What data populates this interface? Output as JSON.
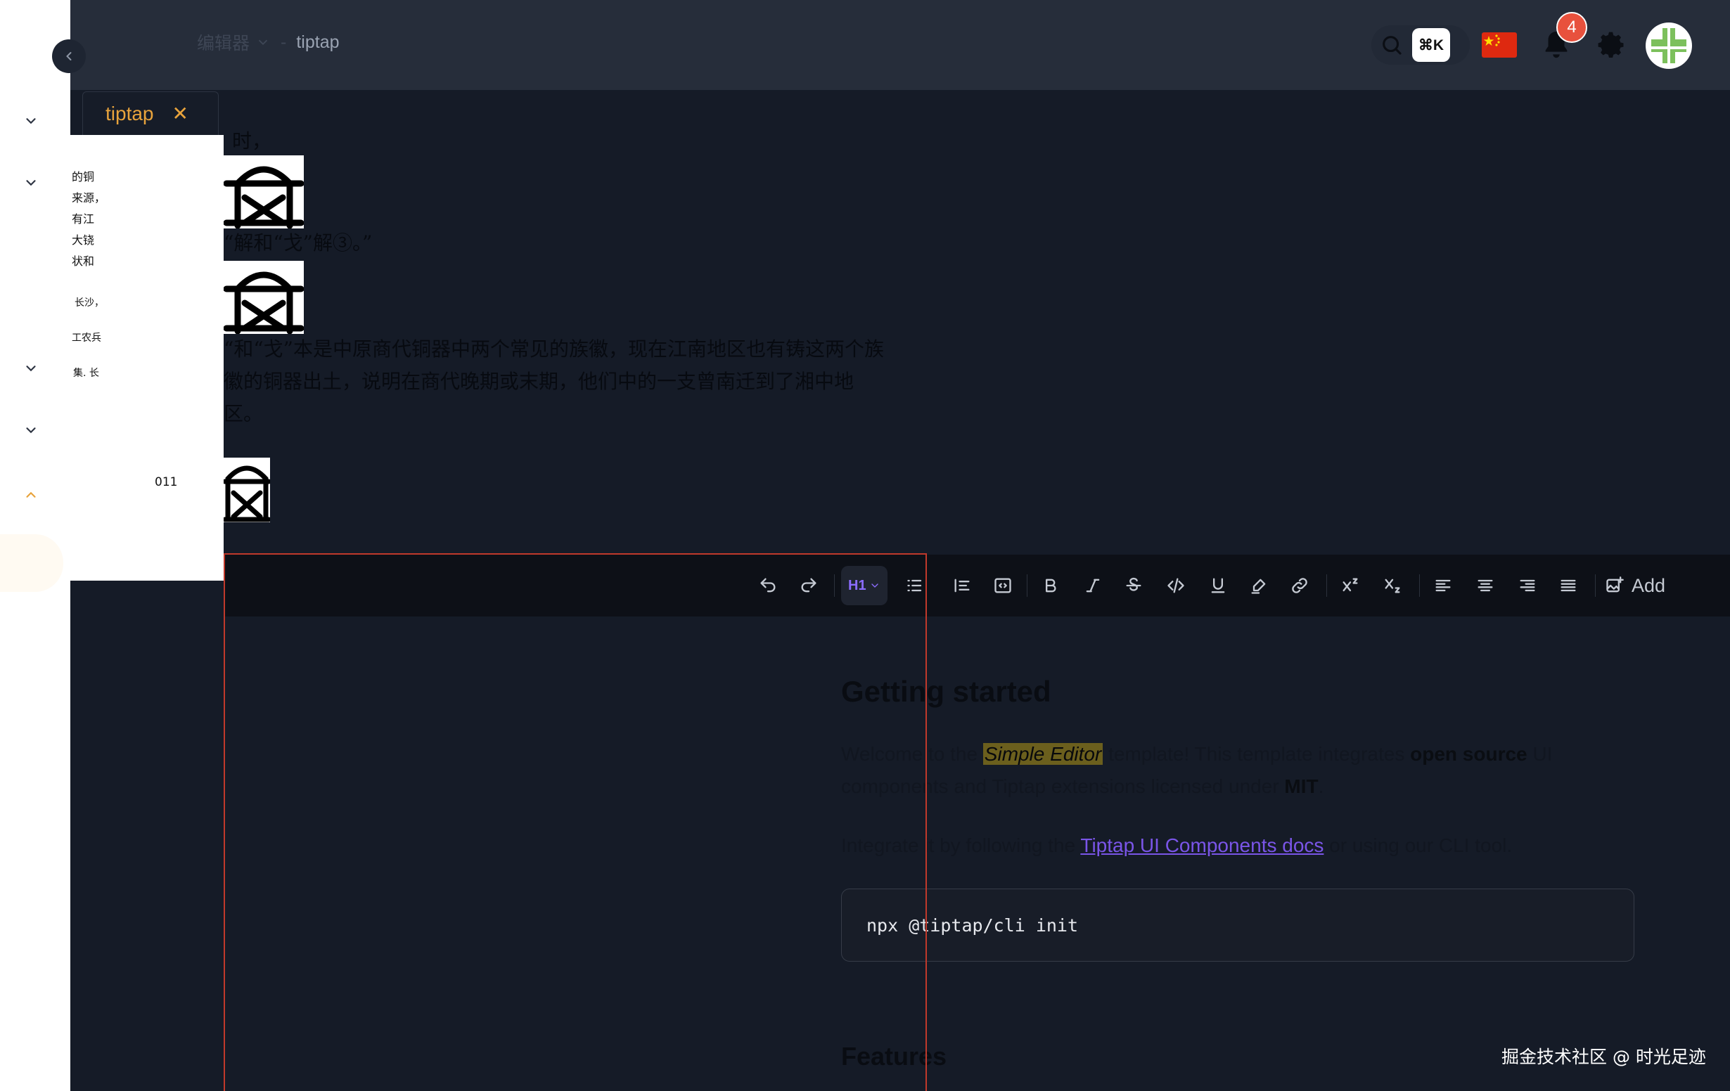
{
  "header": {
    "breadcrumb_root": "编辑器",
    "breadcrumb_sep": "-",
    "breadcrumb_current": "tiptap",
    "search_shortcut": "⌘K",
    "notification_count": "4"
  },
  "tabs": [
    {
      "label": "tiptap",
      "close": "✕"
    }
  ],
  "scan_page": {
    "lines": [
      "时，",
      "的铜",
      "来源，",
      "有江",
      "大铙",
      "状和",
      "长沙，",
      "工农兵",
      "集. 长"
    ],
    "page_number": "011"
  },
  "book_text": {
    "line1": "“解和“戈”解③。”",
    "para": [
      "“和“戈”本是中原商代铜器中两个常见的族徽，现在江南地区也有铸这两个族",
      "徽的铜器出土，说明在商代晚期或末期，他们中的一支曾南迁到了湘中地",
      "区。"
    ]
  },
  "toolbar": {
    "heading_label": "H1",
    "add_label": "Add"
  },
  "document": {
    "title": "Getting started",
    "p1_before": "Welcome to the ",
    "p1_highlight": "Simple Editor",
    "p1_mid": " template! This template integrates ",
    "p1_bold1": "open source",
    "p1_after": " UI components and Tiptap extensions licensed under ",
    "p1_bold2": "MIT",
    "p1_end": ".",
    "p2_before": "Integrate it by following the ",
    "p2_link": "Tiptap UI Components docs",
    "p2_after": " or using our CLI tool.",
    "code": "npx @tiptap/cli init",
    "features_heading": "Features"
  },
  "watermark": "掘金技术社区 @ 时光足迹",
  "colors": {
    "accent": "#e8a33c",
    "link": "#7a55e8",
    "badge": "#e8513d",
    "frame": "#c0392b"
  }
}
